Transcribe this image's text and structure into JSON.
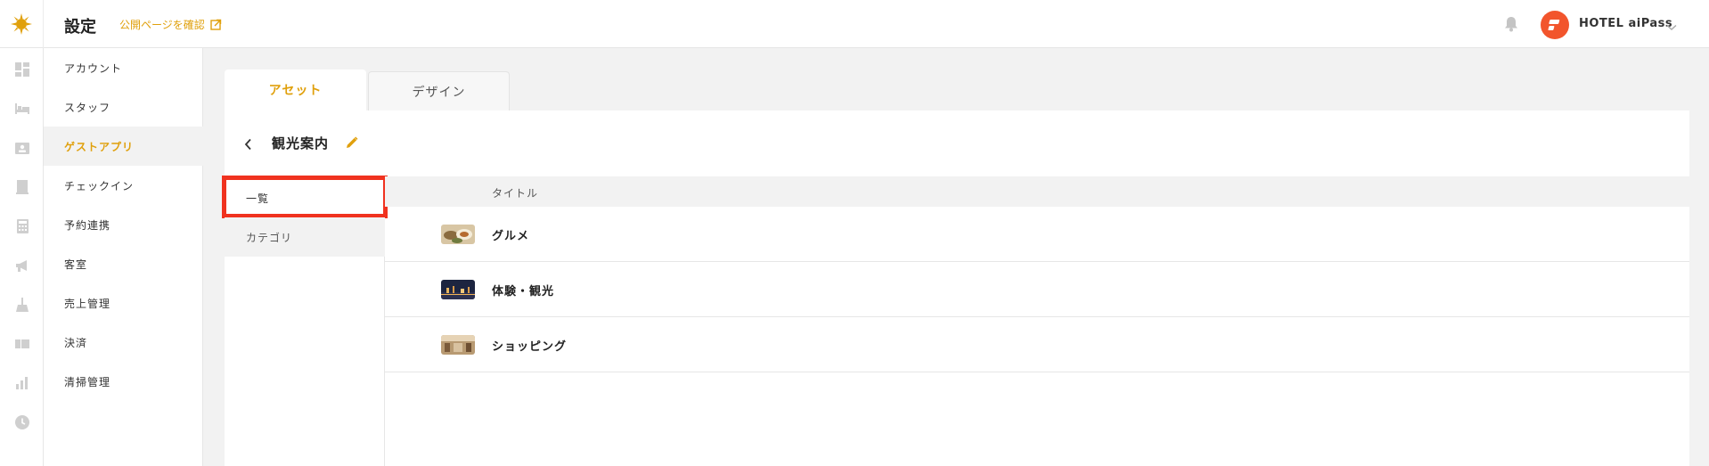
{
  "header": {
    "title": "設定",
    "public_link": "公開ページを確認",
    "account_name": "HOTEL aiPass"
  },
  "rail": {
    "icons": [
      "dashboard-icon",
      "bed-icon",
      "id-card-icon",
      "building-icon",
      "calculator-icon",
      "megaphone-icon",
      "broom-icon",
      "ticket-icon",
      "bar-chart-icon",
      "clock-icon"
    ]
  },
  "sidebar": {
    "items": [
      {
        "label": "アカウント",
        "active": false
      },
      {
        "label": "スタッフ",
        "active": false
      },
      {
        "label": "ゲストアプリ",
        "active": true
      },
      {
        "label": "チェックイン",
        "active": false
      },
      {
        "label": "予約連携",
        "active": false
      },
      {
        "label": "客室",
        "active": false
      },
      {
        "label": "売上管理",
        "active": false
      },
      {
        "label": "決済",
        "active": false
      },
      {
        "label": "清掃管理",
        "active": false
      }
    ]
  },
  "tabs": [
    {
      "label": "アセット",
      "active": true
    },
    {
      "label": "デザイン",
      "active": false
    }
  ],
  "panel": {
    "title": "観光案内",
    "subnav": {
      "list_label": "一覧",
      "category_label": "カテゴリ"
    },
    "table": {
      "column_title": "タイトル",
      "rows": [
        {
          "title": "グルメ",
          "thumb": "food-photo"
        },
        {
          "title": "体験・観光",
          "thumb": "night-city-photo"
        },
        {
          "title": "ショッピング",
          "thumb": "shop-photo"
        }
      ]
    }
  },
  "colors": {
    "accent": "#e0a00c",
    "highlight": "#f0321f",
    "avatar": "#f2552c"
  }
}
